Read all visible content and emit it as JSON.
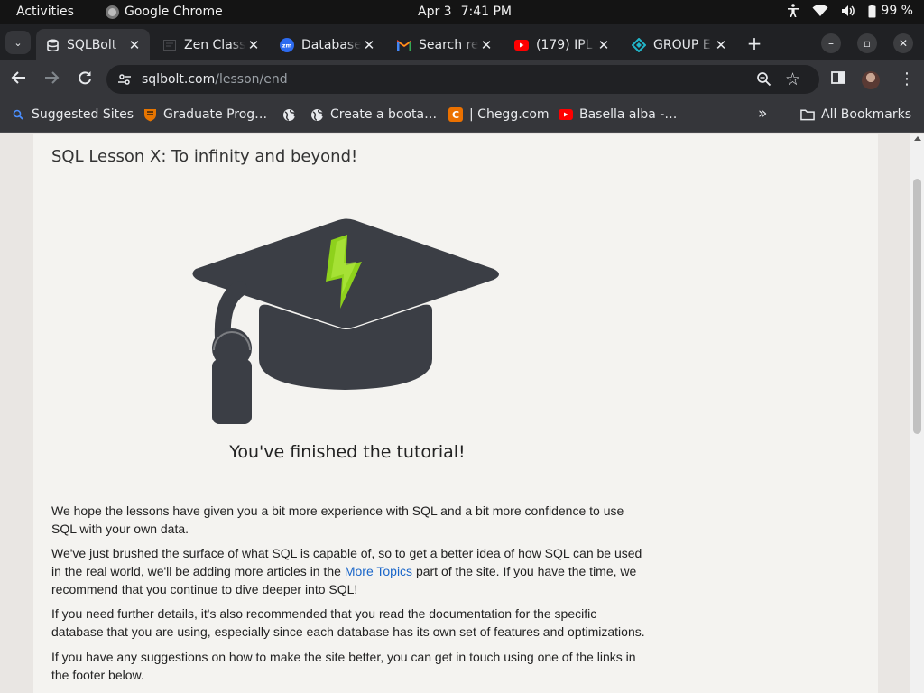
{
  "system": {
    "activities": "Activities",
    "app_name": "Google Chrome",
    "date": "Apr 3",
    "time": "7:41 PM",
    "battery": "99 %"
  },
  "tabs": [
    {
      "title": "SQLBolt",
      "icon": "database-icon",
      "active": true
    },
    {
      "title": "Zen Class",
      "icon": "zen-class-icon",
      "active": false
    },
    {
      "title": "Database",
      "icon": "zoom-icon",
      "active": false
    },
    {
      "title": "Search re",
      "icon": "gmail-icon",
      "active": false
    },
    {
      "title": "(179) IPL",
      "icon": "youtube-icon",
      "active": false
    },
    {
      "title": "GROUP E",
      "icon": "group-icon",
      "active": false
    }
  ],
  "address": {
    "host": "sqlbolt.com",
    "path": "/lesson/end"
  },
  "bookmarks": [
    {
      "label": "Suggested Sites",
      "icon": "search-icon"
    },
    {
      "label": "Graduate Prog…",
      "icon": "princeton-icon"
    },
    {
      "label": "",
      "icon": "globe-icon"
    },
    {
      "label": "Create a boota…",
      "icon": "globe-icon"
    },
    {
      "label": "| Chegg.com",
      "icon": "chegg-icon"
    },
    {
      "label": "Basella alba -…",
      "icon": "youtube-icon"
    }
  ],
  "all_bookmarks": "All Bookmarks",
  "page": {
    "lesson_title": "SQL Lesson X: To infinity and beyond!",
    "finished": "You've finished the tutorial!",
    "p1": "We hope the lessons have given you a bit more experience with SQL and a bit more confidence to use SQL with your own data.",
    "p2_before": "We've just brushed the surface of what SQL is capable of, so to get a better idea of how SQL can be used in the real world, we'll be adding more articles in the ",
    "p2_link": "More Topics",
    "p2_after": " part of the site. If you have the time, we recommend that you continue to dive deeper into SQL!",
    "p3": "If you need further details, it's also recommended that you read the documentation for the specific database that you are using, especially since each database has its own set of features and optimizations.",
    "p4": "If you have any suggestions on how to make the site better, you can get in touch using one of the links in the footer below."
  },
  "colors": {
    "hat": "#3b3e45",
    "bolt": "#8ed11c",
    "link": "#1a66c9"
  }
}
